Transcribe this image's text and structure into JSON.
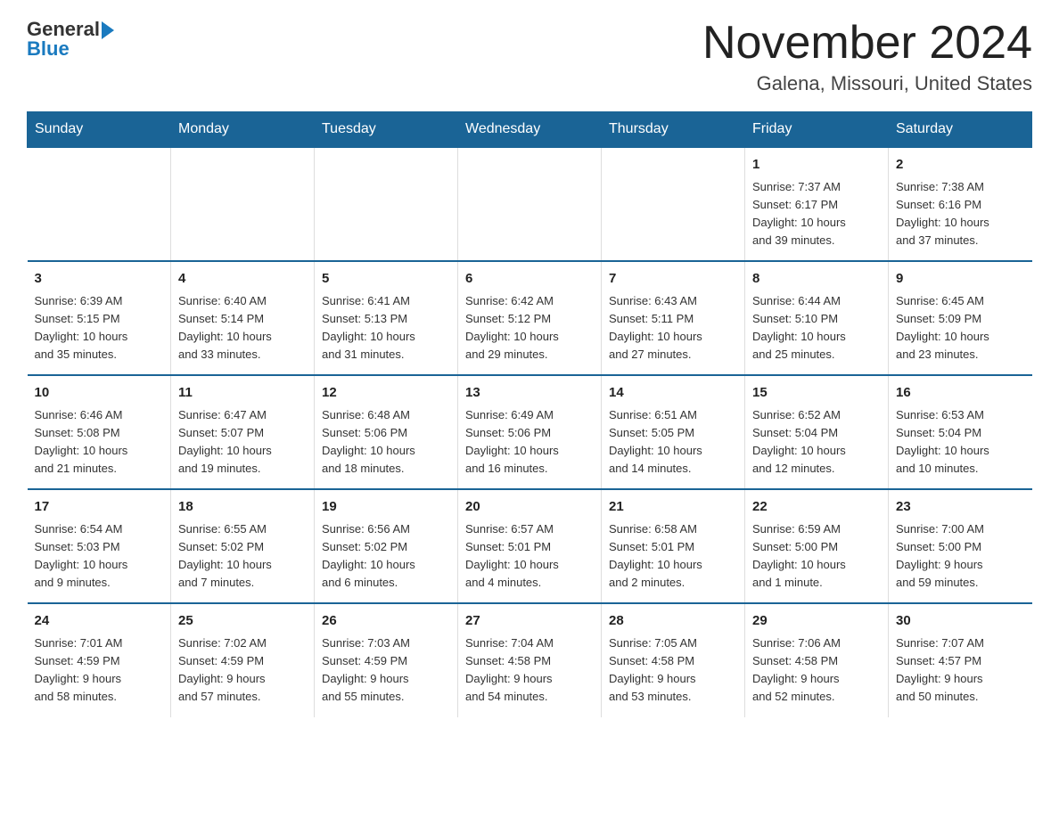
{
  "header": {
    "logo_text_general": "General",
    "logo_text_blue": "Blue",
    "month_title": "November 2024",
    "location": "Galena, Missouri, United States"
  },
  "weekdays": [
    "Sunday",
    "Monday",
    "Tuesday",
    "Wednesday",
    "Thursday",
    "Friday",
    "Saturday"
  ],
  "weeks": [
    [
      {
        "day": "",
        "info": ""
      },
      {
        "day": "",
        "info": ""
      },
      {
        "day": "",
        "info": ""
      },
      {
        "day": "",
        "info": ""
      },
      {
        "day": "",
        "info": ""
      },
      {
        "day": "1",
        "info": "Sunrise: 7:37 AM\nSunset: 6:17 PM\nDaylight: 10 hours\nand 39 minutes."
      },
      {
        "day": "2",
        "info": "Sunrise: 7:38 AM\nSunset: 6:16 PM\nDaylight: 10 hours\nand 37 minutes."
      }
    ],
    [
      {
        "day": "3",
        "info": "Sunrise: 6:39 AM\nSunset: 5:15 PM\nDaylight: 10 hours\nand 35 minutes."
      },
      {
        "day": "4",
        "info": "Sunrise: 6:40 AM\nSunset: 5:14 PM\nDaylight: 10 hours\nand 33 minutes."
      },
      {
        "day": "5",
        "info": "Sunrise: 6:41 AM\nSunset: 5:13 PM\nDaylight: 10 hours\nand 31 minutes."
      },
      {
        "day": "6",
        "info": "Sunrise: 6:42 AM\nSunset: 5:12 PM\nDaylight: 10 hours\nand 29 minutes."
      },
      {
        "day": "7",
        "info": "Sunrise: 6:43 AM\nSunset: 5:11 PM\nDaylight: 10 hours\nand 27 minutes."
      },
      {
        "day": "8",
        "info": "Sunrise: 6:44 AM\nSunset: 5:10 PM\nDaylight: 10 hours\nand 25 minutes."
      },
      {
        "day": "9",
        "info": "Sunrise: 6:45 AM\nSunset: 5:09 PM\nDaylight: 10 hours\nand 23 minutes."
      }
    ],
    [
      {
        "day": "10",
        "info": "Sunrise: 6:46 AM\nSunset: 5:08 PM\nDaylight: 10 hours\nand 21 minutes."
      },
      {
        "day": "11",
        "info": "Sunrise: 6:47 AM\nSunset: 5:07 PM\nDaylight: 10 hours\nand 19 minutes."
      },
      {
        "day": "12",
        "info": "Sunrise: 6:48 AM\nSunset: 5:06 PM\nDaylight: 10 hours\nand 18 minutes."
      },
      {
        "day": "13",
        "info": "Sunrise: 6:49 AM\nSunset: 5:06 PM\nDaylight: 10 hours\nand 16 minutes."
      },
      {
        "day": "14",
        "info": "Sunrise: 6:51 AM\nSunset: 5:05 PM\nDaylight: 10 hours\nand 14 minutes."
      },
      {
        "day": "15",
        "info": "Sunrise: 6:52 AM\nSunset: 5:04 PM\nDaylight: 10 hours\nand 12 minutes."
      },
      {
        "day": "16",
        "info": "Sunrise: 6:53 AM\nSunset: 5:04 PM\nDaylight: 10 hours\nand 10 minutes."
      }
    ],
    [
      {
        "day": "17",
        "info": "Sunrise: 6:54 AM\nSunset: 5:03 PM\nDaylight: 10 hours\nand 9 minutes."
      },
      {
        "day": "18",
        "info": "Sunrise: 6:55 AM\nSunset: 5:02 PM\nDaylight: 10 hours\nand 7 minutes."
      },
      {
        "day": "19",
        "info": "Sunrise: 6:56 AM\nSunset: 5:02 PM\nDaylight: 10 hours\nand 6 minutes."
      },
      {
        "day": "20",
        "info": "Sunrise: 6:57 AM\nSunset: 5:01 PM\nDaylight: 10 hours\nand 4 minutes."
      },
      {
        "day": "21",
        "info": "Sunrise: 6:58 AM\nSunset: 5:01 PM\nDaylight: 10 hours\nand 2 minutes."
      },
      {
        "day": "22",
        "info": "Sunrise: 6:59 AM\nSunset: 5:00 PM\nDaylight: 10 hours\nand 1 minute."
      },
      {
        "day": "23",
        "info": "Sunrise: 7:00 AM\nSunset: 5:00 PM\nDaylight: 9 hours\nand 59 minutes."
      }
    ],
    [
      {
        "day": "24",
        "info": "Sunrise: 7:01 AM\nSunset: 4:59 PM\nDaylight: 9 hours\nand 58 minutes."
      },
      {
        "day": "25",
        "info": "Sunrise: 7:02 AM\nSunset: 4:59 PM\nDaylight: 9 hours\nand 57 minutes."
      },
      {
        "day": "26",
        "info": "Sunrise: 7:03 AM\nSunset: 4:59 PM\nDaylight: 9 hours\nand 55 minutes."
      },
      {
        "day": "27",
        "info": "Sunrise: 7:04 AM\nSunset: 4:58 PM\nDaylight: 9 hours\nand 54 minutes."
      },
      {
        "day": "28",
        "info": "Sunrise: 7:05 AM\nSunset: 4:58 PM\nDaylight: 9 hours\nand 53 minutes."
      },
      {
        "day": "29",
        "info": "Sunrise: 7:06 AM\nSunset: 4:58 PM\nDaylight: 9 hours\nand 52 minutes."
      },
      {
        "day": "30",
        "info": "Sunrise: 7:07 AM\nSunset: 4:57 PM\nDaylight: 9 hours\nand 50 minutes."
      }
    ]
  ]
}
